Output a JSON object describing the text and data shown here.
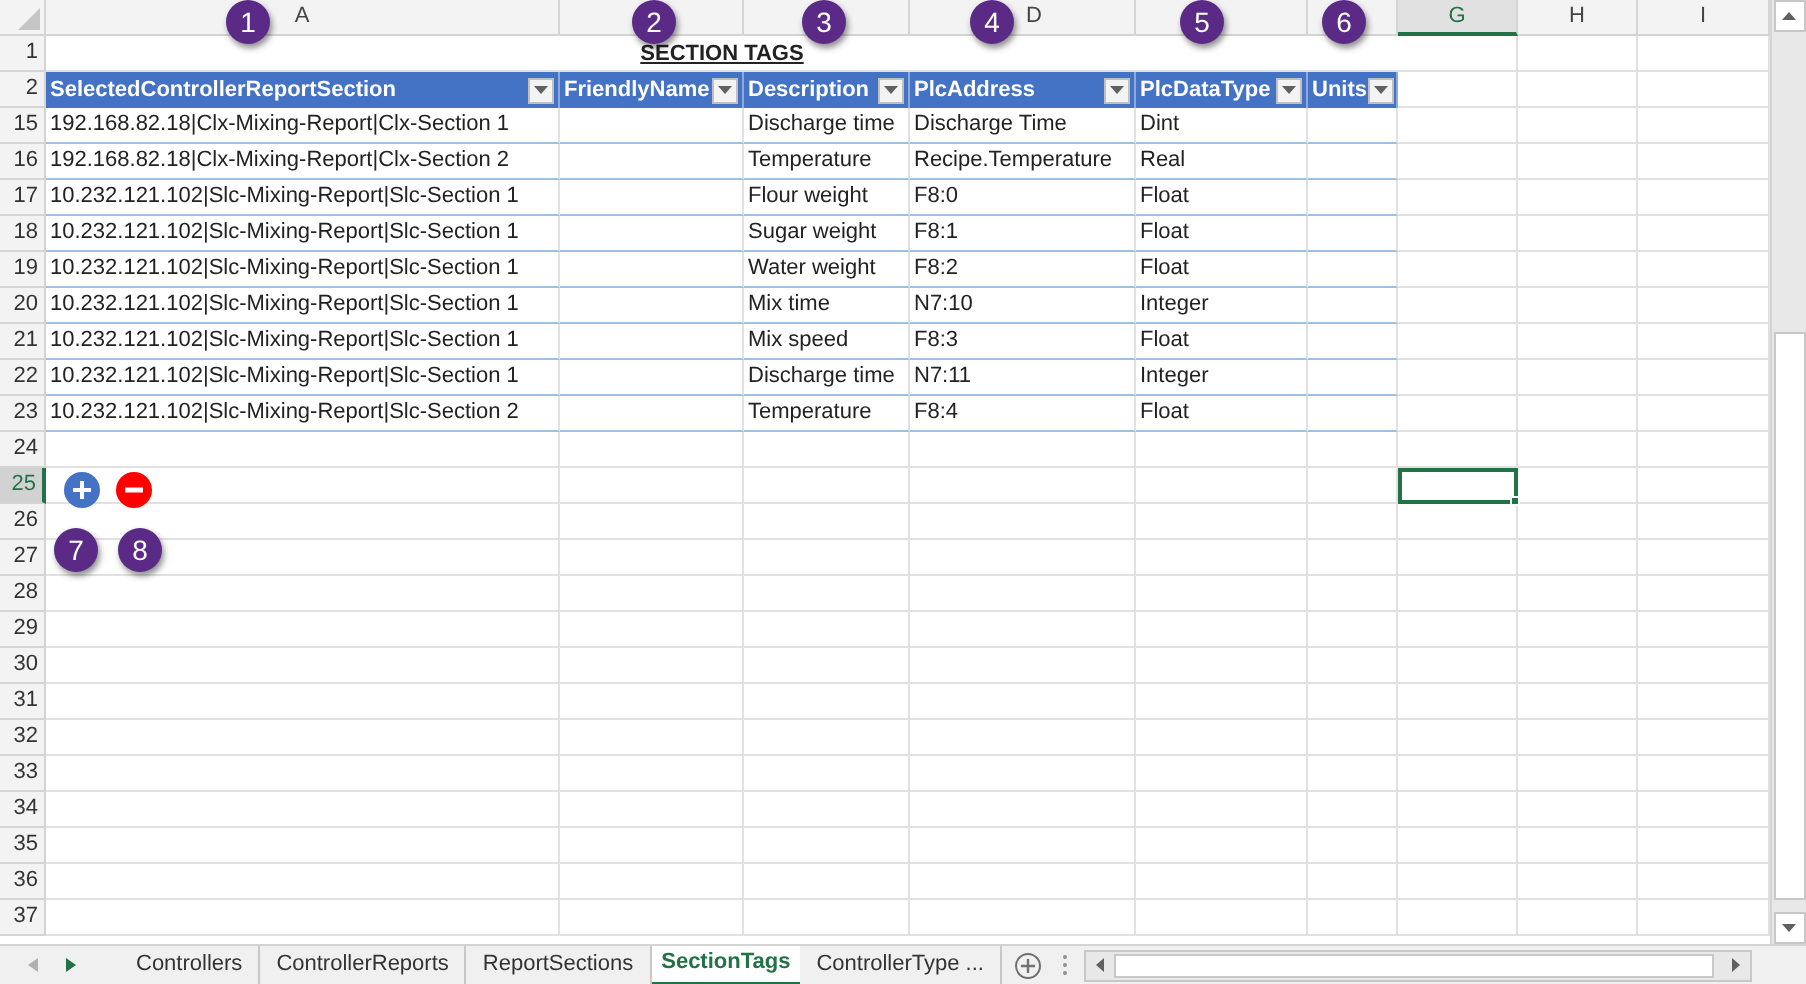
{
  "column_headers": [
    {
      "label": "A",
      "selected": false
    },
    {
      "label": "D",
      "selected": false
    },
    {
      "label": "G",
      "selected": true
    },
    {
      "label": "H",
      "selected": false
    },
    {
      "label": "I",
      "selected": false
    }
  ],
  "title_row": {
    "number": "1",
    "text": "SECTION TAGS"
  },
  "table": {
    "header_row_number": "2",
    "columns": [
      {
        "label": "SelectedControllerReportSection"
      },
      {
        "label": "FriendlyName"
      },
      {
        "label": "Description"
      },
      {
        "label": "PlcAddress"
      },
      {
        "label": "PlcDataType"
      },
      {
        "label": "Units"
      }
    ],
    "rows": [
      {
        "row_number": "15",
        "section": "192.168.82.18|Clx-Mixing-Report|Clx-Section 1",
        "description": "Discharge time",
        "plc_address": "Discharge Time",
        "plc_data_type": "Dint"
      },
      {
        "row_number": "16",
        "section": "192.168.82.18|Clx-Mixing-Report|Clx-Section 2",
        "description": "Temperature",
        "plc_address": "Recipe.Temperature",
        "plc_data_type": "Real"
      },
      {
        "row_number": "17",
        "section": "10.232.121.102|Slc-Mixing-Report|Slc-Section 1",
        "description": "Flour weight",
        "plc_address": "F8:0",
        "plc_data_type": "Float"
      },
      {
        "row_number": "18",
        "section": "10.232.121.102|Slc-Mixing-Report|Slc-Section 1",
        "description": "Sugar weight",
        "plc_address": "F8:1",
        "plc_data_type": "Float"
      },
      {
        "row_number": "19",
        "section": "10.232.121.102|Slc-Mixing-Report|Slc-Section 1",
        "description": "Water weight",
        "plc_address": "F8:2",
        "plc_data_type": "Float"
      },
      {
        "row_number": "20",
        "section": "10.232.121.102|Slc-Mixing-Report|Slc-Section 1",
        "description": "Mix time",
        "plc_address": "N7:10",
        "plc_data_type": "Integer"
      },
      {
        "row_number": "21",
        "section": "10.232.121.102|Slc-Mixing-Report|Slc-Section 1",
        "description": "Mix speed",
        "plc_address": "F8:3",
        "plc_data_type": "Float"
      },
      {
        "row_number": "22",
        "section": "10.232.121.102|Slc-Mixing-Report|Slc-Section 1",
        "description": "Discharge time",
        "plc_address": "N7:11",
        "plc_data_type": "Integer"
      },
      {
        "row_number": "23",
        "section": "10.232.121.102|Slc-Mixing-Report|Slc-Section 2",
        "description": "Temperature",
        "plc_address": "F8:4",
        "plc_data_type": "Float"
      }
    ]
  },
  "empty_rows": [
    {
      "number": "24",
      "selected": false
    },
    {
      "number": "25",
      "selected": true
    },
    {
      "number": "26",
      "selected": false
    },
    {
      "number": "27",
      "selected": false
    },
    {
      "number": "28",
      "selected": false
    },
    {
      "number": "29",
      "selected": false
    },
    {
      "number": "30",
      "selected": false
    },
    {
      "number": "31",
      "selected": false
    },
    {
      "number": "32",
      "selected": false
    },
    {
      "number": "33",
      "selected": false
    },
    {
      "number": "34",
      "selected": false
    },
    {
      "number": "35",
      "selected": false
    },
    {
      "number": "36",
      "selected": false
    },
    {
      "number": "37",
      "selected": false
    }
  ],
  "row_buttons": [
    {
      "kind": "add"
    },
    {
      "kind": "remove"
    }
  ],
  "callouts": [
    "1",
    "2",
    "3",
    "4",
    "5",
    "6",
    "7",
    "8"
  ],
  "sheet_tabs": [
    {
      "label": "Controllers",
      "selected": false
    },
    {
      "label": "ControllerReports",
      "selected": false
    },
    {
      "label": "ReportSections",
      "selected": false
    },
    {
      "label": "SectionTags",
      "selected": true
    },
    {
      "label": "ControllerType ...",
      "selected": false
    }
  ]
}
